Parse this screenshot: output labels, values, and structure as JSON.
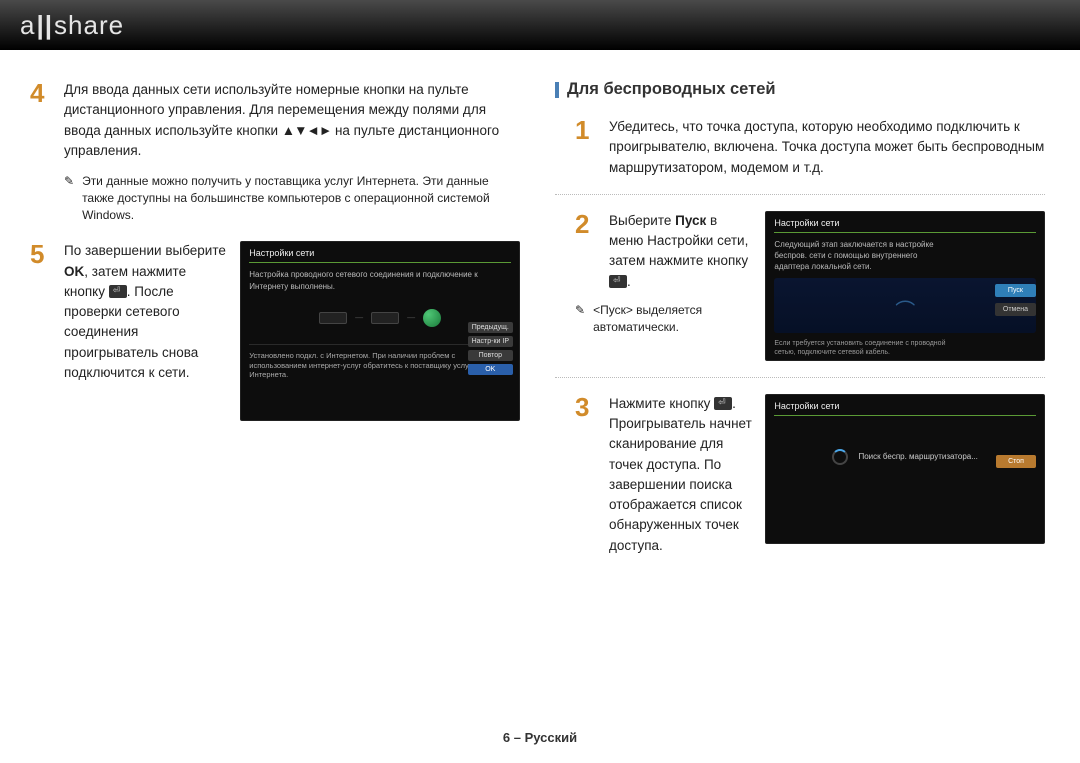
{
  "logo_text": "a||share",
  "left": {
    "step4": {
      "num": "4",
      "text_a": "Для ввода данных сети используйте номерные кнопки на пульте дистанционного управления. Для перемещения между полями для ввода данных используйте кнопки ",
      "arrows": "▲▼◄►",
      "text_b": " на пульте дистанционного управления."
    },
    "step4_note": "Эти данные можно получить у поставщика услуг Интернета. Эти данные также доступны на большинстве компьютеров с операционной системой Windows.",
    "step5": {
      "num": "5",
      "text_a": "По завершении выберите ",
      "bold1": "OK",
      "text_b": ", затем нажмите кнопку ",
      "text_c": ". После проверки сетевого соединения проигрыватель снова подключится к сети."
    },
    "ss5": {
      "title": "Настройки сети",
      "line1": "Настройка проводного сетевого соединения и подключение к Интернету выполнены.",
      "bottom": "Установлено подкл. с Интернетом. При наличии проблем с использованием интернет-услуг обратитесь к поставщику услуг Интернета.",
      "btn_prev": "Предыдущ.",
      "btn_ip": "Настр-ки IP",
      "btn_retry": "Повтор",
      "btn_ok": "OK"
    }
  },
  "right": {
    "heading": "Для беспроводных сетей",
    "step1": {
      "num": "1",
      "text": "Убедитесь, что точка доступа, которую необходимо подключить к проигрывателю, включена. Точка доступа может быть беспроводным маршрутизатором, модемом и т.д."
    },
    "step2": {
      "num": "2",
      "text_a": "Выберите ",
      "bold": "Пуск",
      "text_b": " в меню Настройки сети, затем нажмите кнопку ",
      "text_c": "."
    },
    "step2_note_a": "<",
    "step2_note_bold": "Пуск",
    "step2_note_b": "> выделяется автоматически.",
    "ss2": {
      "title": "Настройки сети",
      "body": "Следующий этап заключается в настройке беспров. сети с помощью внутреннего адаптера локальной сети.",
      "btn_start": "Пуск",
      "btn_cancel": "Отмена",
      "foot": "Если требуется установить соединение с проводной сетью, подключите сетевой кабель."
    },
    "step3": {
      "num": "3",
      "text_a": "Нажмите кнопку ",
      "text_b": ". Проигрыватель начнет сканирование для точек доступа. По завершении поиска отображается список обнаруженных точек доступа."
    },
    "ss3": {
      "title": "Настройки сети",
      "search": "Поиск беспр. маршрутизатора...",
      "btn_stop": "Стоп"
    }
  },
  "footer": "6 – Русский"
}
